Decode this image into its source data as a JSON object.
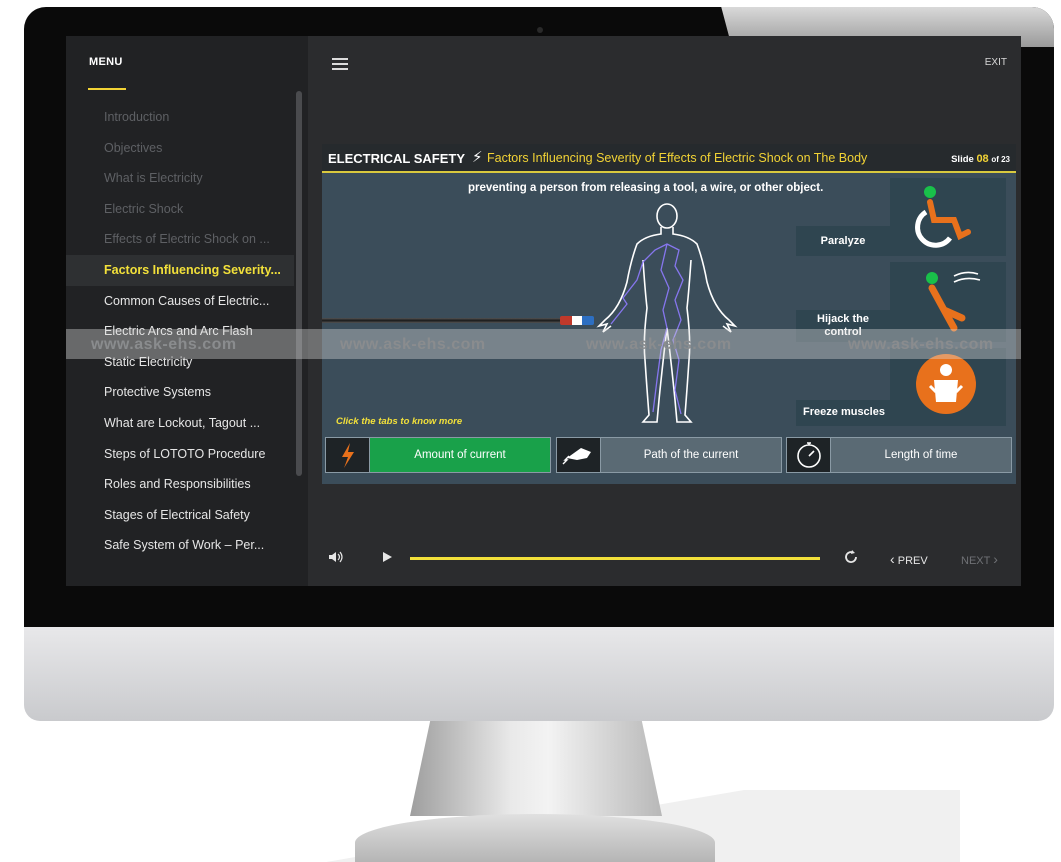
{
  "sidebar": {
    "title": "MENU",
    "items": [
      {
        "label": "Introduction",
        "state": "dim"
      },
      {
        "label": "Objectives",
        "state": "dim"
      },
      {
        "label": "What is Electricity",
        "state": "dim"
      },
      {
        "label": "Electric Shock",
        "state": "dim"
      },
      {
        "label": "Effects of Electric Shock on ...",
        "state": "dim"
      },
      {
        "label": "Factors Influencing Severity...",
        "state": "active"
      },
      {
        "label": "Common Causes of Electric...",
        "state": "normal"
      },
      {
        "label": "Electric Arcs and Arc Flash",
        "state": "normal"
      },
      {
        "label": "Static Electricity",
        "state": "normal"
      },
      {
        "label": "Protective Systems",
        "state": "normal"
      },
      {
        "label": "What are Lockout, Tagout ...",
        "state": "normal"
      },
      {
        "label": "Steps of LOTOTO Procedure",
        "state": "normal"
      },
      {
        "label": "Roles and Responsibilities",
        "state": "normal"
      },
      {
        "label": "Stages of Electrical Safety",
        "state": "normal"
      },
      {
        "label": "Safe System of Work – Per...",
        "state": "normal"
      }
    ]
  },
  "topbar": {
    "exit_label": "EXIT"
  },
  "slide": {
    "header_main": "ELECTRICAL SAFETY",
    "header_sub": "Factors Influencing Severity of Effects of Electric Shock on The Body",
    "slide_prefix": "Slide",
    "slide_number": "08",
    "slide_total": "of 23",
    "text": "preventing a person from releasing a tool, a wire, or other object.",
    "effects": {
      "paralyze": "Paralyze",
      "hijack_line1": "Hijack the",
      "hijack_line2": "control",
      "freeze": "Freeze muscles"
    },
    "hint": "Click the tabs to know more",
    "tabs": [
      {
        "label": "Amount of current",
        "state": "active",
        "icon": "lightning-icon"
      },
      {
        "label": "Path of the current",
        "state": "inactive",
        "icon": "hand-shock-icon"
      },
      {
        "label": "Length of time",
        "state": "inactive",
        "icon": "stopwatch-icon"
      }
    ]
  },
  "watermark": "www.ask-ehs.com",
  "player": {
    "prev_label": "PREV",
    "next_label": "NEXT",
    "progress": 1.0
  },
  "colors": {
    "accent": "#f2e03a",
    "active_tab": "#19a14a",
    "slide_bg": "#3b4d5a",
    "orange": "#e8711c"
  }
}
